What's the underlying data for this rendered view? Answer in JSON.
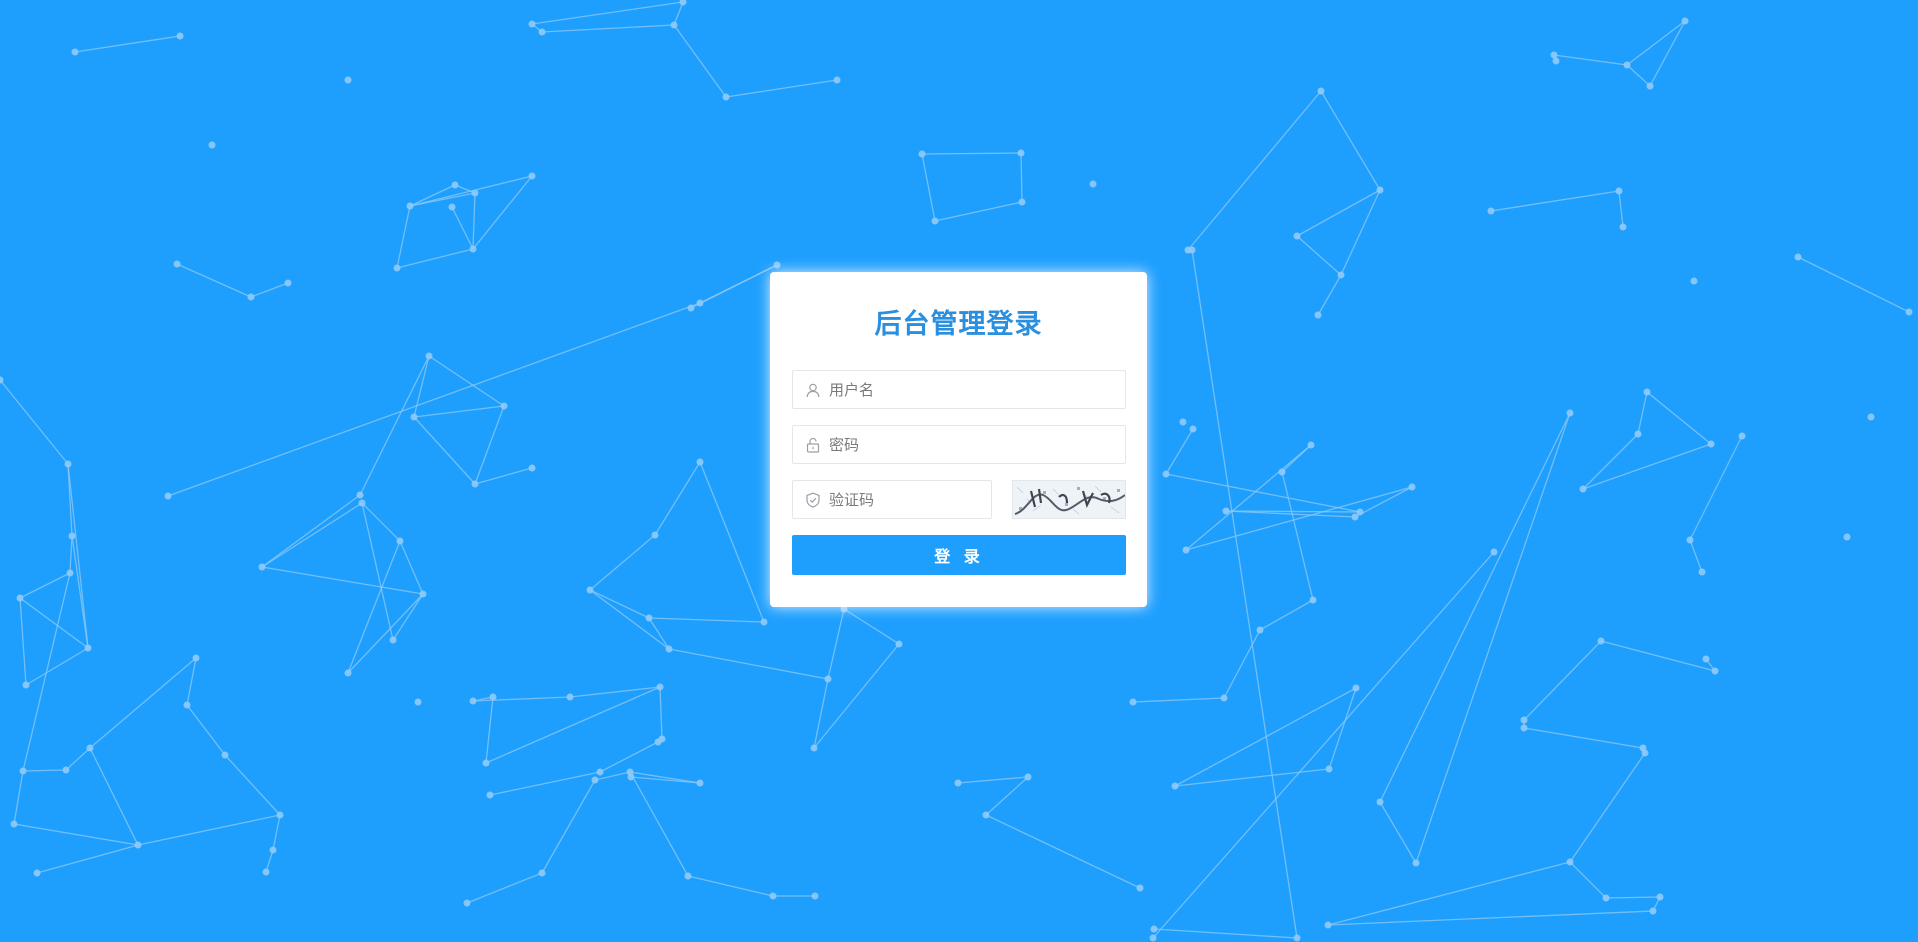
{
  "login": {
    "title": "后台管理登录",
    "username_placeholder": "用户名",
    "password_placeholder": "密码",
    "captcha_placeholder": "验证码",
    "submit_label": "登 录"
  },
  "icons": {
    "username": "user-icon",
    "password": "lock-icon",
    "captcha": "shield-check-icon"
  },
  "colors": {
    "background": "#1e9ffe",
    "title": "#2a8fde",
    "button": "#1e9ffe",
    "network": "#8fcaf6"
  }
}
